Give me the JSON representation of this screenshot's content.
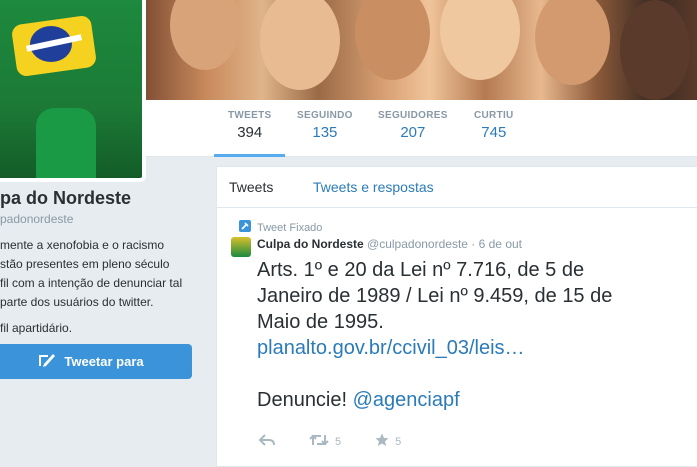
{
  "profile": {
    "name": "pa do Nordeste",
    "handle": "padonordeste",
    "bio_lines": [
      "mente a xenofobia e o racismo",
      "stão presentes em pleno século",
      "fil com a intenção de denunciar tal",
      " parte dos usuários do twitter."
    ],
    "bio_extra": "fil apartidário.",
    "tweet_to_label": "Tweetar para"
  },
  "stats": [
    {
      "label": "TWEETS",
      "value": "394"
    },
    {
      "label": "SEGUINDO",
      "value": "135"
    },
    {
      "label": "SEGUIDORES",
      "value": "207"
    },
    {
      "label": "CURTIU",
      "value": "745"
    }
  ],
  "tabs": [
    "Tweets",
    "Tweets e respostas"
  ],
  "tweet": {
    "pinned_label": "Tweet Fixado",
    "author_name": "Culpa do Nordeste",
    "author_handle": "@culpadonordeste",
    "date": "· 6 de out",
    "lines": [
      "Arts. 1º e 20 da Lei nº 7.716, de 5 de",
      "Janeiro de 1989 / Lei nº 9.459, de 15 de",
      "Maio de 1995."
    ],
    "link": "planalto.gov.br/ccivil_03/leis…",
    "closing": "Denuncie! ",
    "mention": "@agenciapf",
    "retweet_count": "5",
    "like_count": "5"
  },
  "colors": {
    "accent": "#55acee",
    "link": "#2b7bb9",
    "button": "#3b94d9"
  }
}
